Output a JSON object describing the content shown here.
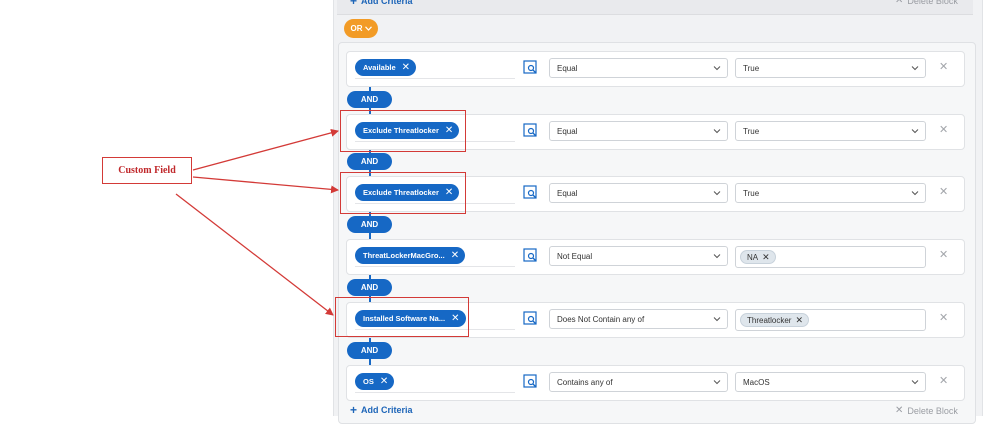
{
  "toolbar": {
    "add_criteria": "Add Criteria",
    "delete_block": "Delete Block"
  },
  "or_badge": {
    "label": "OR"
  },
  "and_label": "AND",
  "rows": [
    {
      "field": "Available",
      "operator": "Equal",
      "value": "True",
      "value_kind": "select"
    },
    {
      "field": "Exclude Threatlocker",
      "operator": "Equal",
      "value": "True",
      "value_kind": "select"
    },
    {
      "field": "Exclude Threatlocker",
      "operator": "Equal",
      "value": "True",
      "value_kind": "select"
    },
    {
      "field": "ThreatLockerMacGro...",
      "operator": "Not Equal",
      "value": "NA",
      "value_kind": "tag"
    },
    {
      "field": "Installed Software Na...",
      "operator": "Does Not Contain any of",
      "value": "Threatlocker",
      "value_kind": "tag"
    },
    {
      "field": "OS",
      "operator": "Contains any of",
      "value": "MacOS",
      "value_kind": "select"
    }
  ],
  "annotation": {
    "label": "Custom Field"
  },
  "colors": {
    "primary": "#1668c5",
    "or_badge": "#f29b26",
    "annotation_red": "#d33a37"
  }
}
